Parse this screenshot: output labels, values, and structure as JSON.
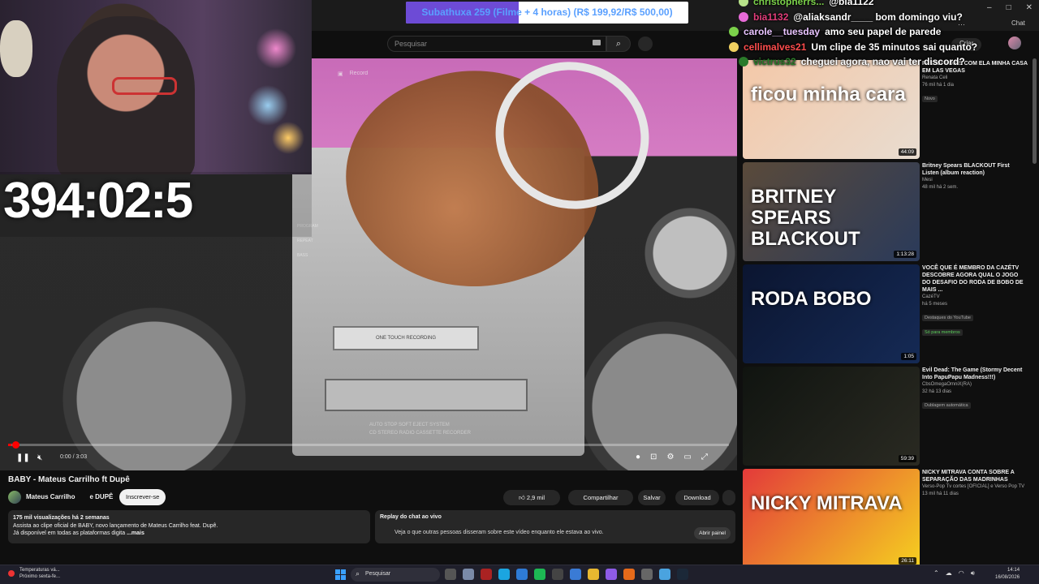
{
  "subathon": {
    "text": "Subathuxa 259 (Filme + 4 horas) (R$ 199,92/R$ 500,00)",
    "progress": 0.4,
    "fill_color": "#6d4bd6"
  },
  "timer": "394:02:5",
  "chat": [
    {
      "user": "christopherrs...",
      "msg": "@bia1122",
      "color": "#7bd14a",
      "badge": "#b8e38a"
    },
    {
      "user": "bia1132",
      "msg": "@aliaksandr____ bom domingo viu?",
      "color": "#e23d7a",
      "badge": "#e86bd8"
    },
    {
      "user": "carole__tuesday",
      "msg": "amo seu papel de parede",
      "color": "#e9c4ff",
      "badge": "#7bd14a"
    },
    {
      "user": "cellimalves21",
      "msg": "Um clipe de 35 minutos sai quanto?",
      "color": "#ff4d4d",
      "badge": "#f0d060"
    },
    {
      "user": "victrus32",
      "msg": "cheguei agora, nao vai ter discord?",
      "color": "#2a7a2a",
      "badge": "#2a7a2a"
    }
  ],
  "yt": {
    "search_placeholder": "Pesquisar",
    "create_label": "Criar",
    "record_label": "Record"
  },
  "browser": {
    "chat_chip": "Chat"
  },
  "player": {
    "time": "0:00 / 3:03",
    "progress": 0.005,
    "side_labels": [
      "PROGRAM",
      "REPEAT",
      "BASS"
    ],
    "cassette_label": "ONE TOUCH RECORDING",
    "caption_1": "AUTO STOP SOFT EJECT SYSTEM",
    "caption_2": "CD STEREO RADIO CASSETTE RECORDER"
  },
  "video": {
    "title": "BABY - Mateus Carrilho ft Dupê",
    "channel_1": "Mateus Carrilho",
    "channel_2": "e DUPÊ",
    "subscribe": "Inscrever-se",
    "likes": "2,9 mil",
    "share": "Compartilhar",
    "save": "Salvar",
    "download": "Download",
    "views": "175 mil visualizações  há 2 semanas",
    "desc_1": "Assista ao clipe oficial de BABY, novo lançamento de Mateus Carrilho feat. Dupê.",
    "desc_2": "Já disponível em todas as plataformas digita",
    "more": "...mais",
    "replay_title": "Replay do chat ao vivo",
    "replay_desc": "Veja o que outras pessoas disseram sobre este vídeo enquanto ele estava ao vivo.",
    "replay_btn": "Abrir painel"
  },
  "recommendations": [
    {
      "title": "PASSEI 3 DIAS COM ELA MINHA CASA EM LAS VEGAS",
      "channel": "Renata Celi",
      "meta": "76 mil  há 1 dia",
      "badge": "Novo",
      "duration": "44:09",
      "thumb_text": "ficou minha cara",
      "c1": "#f4c8a8",
      "c2": "#e8dcd0"
    },
    {
      "title": "Britney Spears BLACKOUT First Listen (album reaction)",
      "channel": "Mesi",
      "meta": "48 mil  há 2 sem.",
      "badge": "",
      "duration": "1:13:28",
      "thumb_text": "BRITNEY SPEARS BLACKOUT",
      "c1": "#5a4a3a",
      "c2": "#2a3a5a"
    },
    {
      "title": "VOCÊ QUE É MEMBRO DA CAZÉTV DESCOBRE AGORA QUAL O JOGO DO DESAFIO DO RODA DE BOBO DE MAIS ...",
      "channel": "CazéTV",
      "meta": "há 5 meses",
      "badge": "Destaques do YouTube",
      "badge2": "Só para membros",
      "duration": "1:05",
      "thumb_text": "RODA BOBO",
      "c1": "#0b1530",
      "c2": "#152a55"
    },
    {
      "title": "Evil Dead: The Game (Stormy Decent Into PapuPapu Madness!!!)",
      "channel": "CbsOmegaOmniX(RA)",
      "meta": "32  há 13 dias",
      "badge": "Dublagem automática",
      "duration": "59:39",
      "thumb_text": "",
      "c1": "#101410",
      "c2": "#2a2a22"
    },
    {
      "title": "NICKY MITRAVA CONTA SOBRE A SEPARAÇÃO DAS MADRINHAS",
      "channel": "Verso-Pop Tv cortes [OFICIAL] e Verso Pop TV",
      "meta": "13 mil  há 11 dias",
      "badge": "",
      "duration": "26:11",
      "thumb_text": "NICKY MITRAVA",
      "c1": "#e33a3a",
      "c2": "#f5d020"
    }
  ],
  "taskbar": {
    "weather_1": "Temperaturas vá...",
    "weather_2": "Próximo sexta-fe...",
    "search": "Pesquisar",
    "time": "14:14",
    "date": "16/08/2026"
  }
}
